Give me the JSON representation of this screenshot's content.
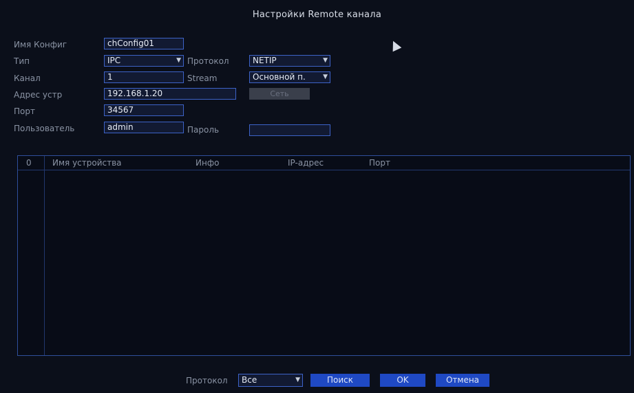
{
  "dialog": {
    "title": "Настройки Remote канала"
  },
  "form": {
    "config_name_label": "Имя Конфиг",
    "config_name_value": "chConfig01",
    "type_label": "Тип",
    "type_value": "IPC",
    "protocol_label": "Протокол",
    "protocol_value": "NETIP",
    "channel_label": "Канал",
    "channel_value": "1",
    "stream_label": "Stream",
    "stream_value": "Основной п.",
    "device_address_label": "Адрес устр",
    "device_address_value": "192.168.1.20",
    "disabled_button_label": "Сеть",
    "port_label": "Порт",
    "port_value": "34567",
    "user_label": "Пользователь",
    "user_value": "admin",
    "password_label": "Пароль",
    "password_value": ""
  },
  "table": {
    "columns": [
      "0",
      "Имя устройства",
      "Инфо",
      "IP-адрес",
      "Порт"
    ],
    "rows": []
  },
  "footer": {
    "protocol_label": "Протокол",
    "protocol_filter_value": "Все",
    "search_label": "Поиск",
    "ok_label": "OK",
    "cancel_label": "Отмена"
  }
}
